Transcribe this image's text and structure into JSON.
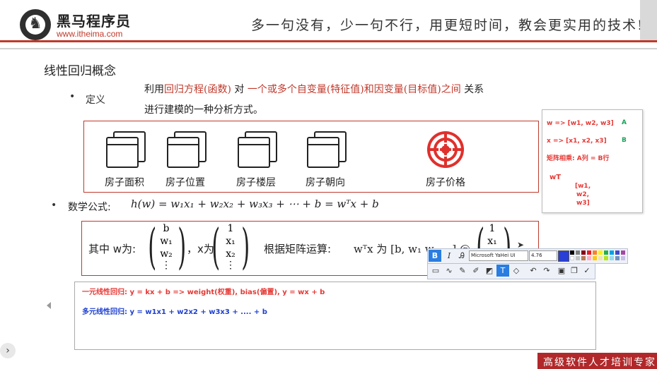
{
  "header": {
    "brand": "黑马程序员",
    "site": "www.itheima.com",
    "slogan": "多一句没有，少一句不行，用更短时间，教会更实用的技术!"
  },
  "title": "线性回归概念",
  "definition": {
    "label": "定义",
    "prefix": "利用",
    "term1": "回归方程(函数)",
    "mid": " 对 ",
    "term2": "一个或多个自变量(特征值)和因变量(目标值)之间",
    "suffix": " 关系",
    "line2": "进行建模的一种分析方式。"
  },
  "features": [
    {
      "label": "房子面积",
      "icon": "window-icon"
    },
    {
      "label": "房子位置",
      "icon": "window-icon"
    },
    {
      "label": "房子楼层",
      "icon": "window-icon"
    },
    {
      "label": "房子朝向",
      "icon": "window-icon"
    },
    {
      "label": "房子价格",
      "icon": "target-icon"
    }
  ],
  "formula": {
    "label": "数学公式:",
    "expr": "h(w) = w₁x₁ + w₂x₂ + w₃x₃ + ⋯ + b = wᵀx + b"
  },
  "matrix": {
    "prefix": "其中 w为:",
    "w_vec": [
      "b",
      "w₁",
      "w₂",
      "⋮"
    ],
    "x_prefix": "，x为",
    "x_vec": [
      "1",
      "x₁",
      "x₂",
      "⋮"
    ],
    "op_text": "根据矩阵运算:",
    "op_expr": "wᵀx 为 [b, w₁ w₂ …] @",
    "tail_vec": [
      "1",
      "x₁"
    ]
  },
  "notes": {
    "line1": "一元线性回归:   y = kx + b => weight(权重),   bias(偏置),     y = wx + b",
    "line2": "多元线性回归:   y = w1x1 + w2x2 + w3x3 + .... +  b"
  },
  "sidebox": {
    "l1": "w => [w1, w2, w3]",
    "l1tag": "A",
    "l2": "x => [x1, x2, x3]",
    "l2tag": "B",
    "l3": "矩阵相乘: A列 = B行",
    "l4": "wT",
    "l5": "[w1,",
    "l6": "w2,",
    "l7": "w3]"
  },
  "toolbar": {
    "font": "Microsoft YaHei UI",
    "size": "4.76",
    "bold": "B",
    "italic": "I",
    "text_tool": "T"
  },
  "footer": {
    "tagline": "高级软件人才培训专家"
  },
  "colors": {
    "accent_red": "#c0392b",
    "note_red": "#e53935",
    "note_blue": "#1e40d0",
    "tool_blue": "#2a7de1"
  }
}
